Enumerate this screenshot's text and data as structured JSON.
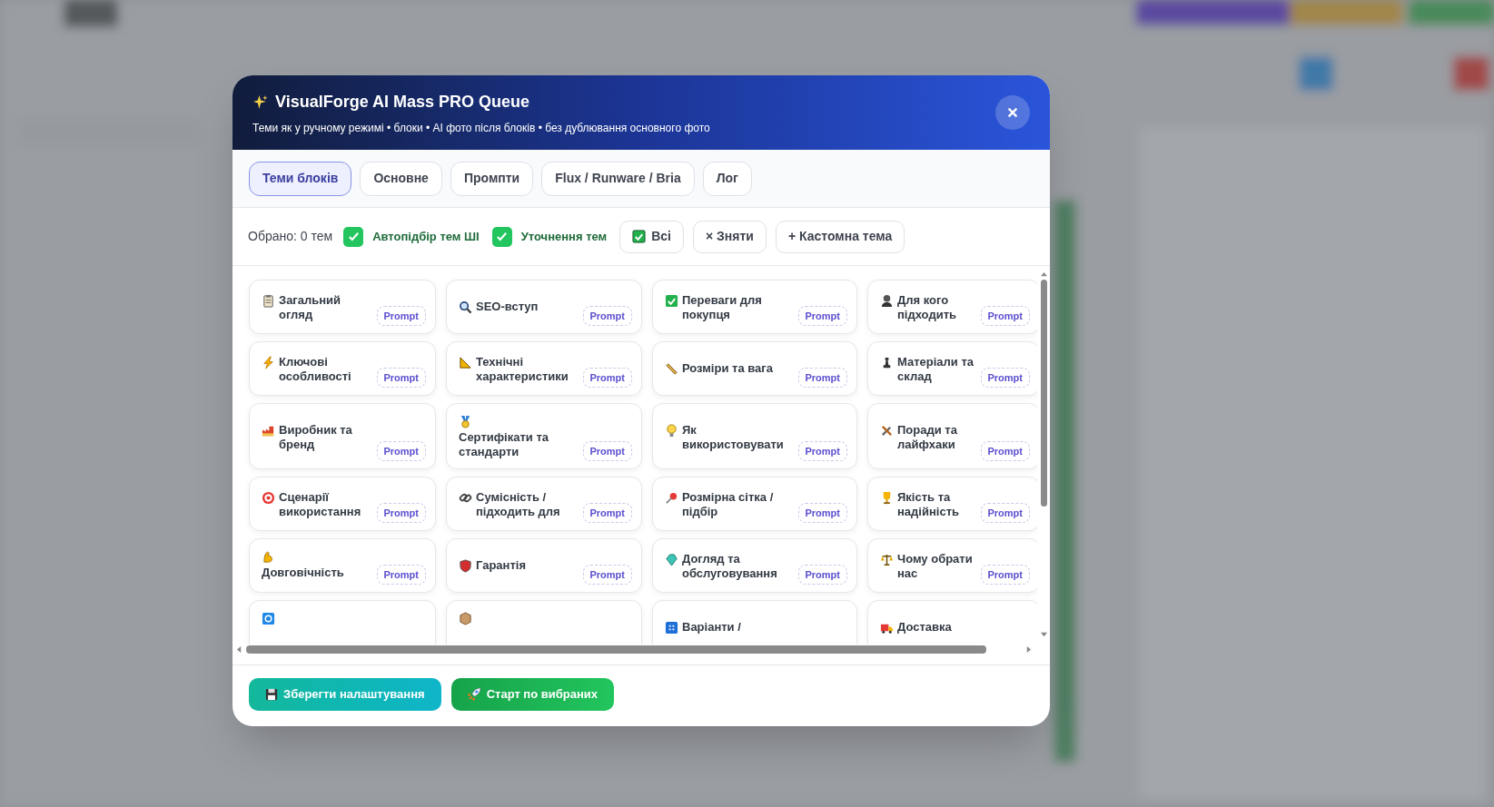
{
  "dialog": {
    "title": "VisualForge AI Mass PRO Queue",
    "subtitle": "Теми як у ручному режимі • блоки • AI фото після блоків • без дублювання основного фото"
  },
  "tabs": [
    {
      "label": "Теми блоків",
      "selected": true
    },
    {
      "label": "Основне",
      "selected": false
    },
    {
      "label": "Промпти",
      "selected": false
    },
    {
      "label": "Flux / Runware / Bria",
      "selected": false
    },
    {
      "label": "Лог",
      "selected": false
    }
  ],
  "filter_bar": {
    "selected_count": "Обрано: 0 тем",
    "toggles": [
      {
        "label": "Автопідбір тем ШІ",
        "checked": true
      },
      {
        "label": "Уточнення тем",
        "checked": true
      }
    ],
    "buttons": [
      {
        "kind": "check",
        "label": "Всі"
      },
      {
        "kind": "plain",
        "label": "× Зняти"
      },
      {
        "kind": "plain",
        "label": "+ Кастомна тема"
      }
    ]
  },
  "topics": [
    {
      "kind": "inline",
      "title": "Загальний огляд",
      "badge": "Prompt"
    },
    {
      "kind": "inline",
      "title": "SEO-вступ",
      "badge": "Prompt"
    },
    {
      "kind": "inline",
      "title": "Переваги для покупця",
      "badge": "Prompt"
    },
    {
      "kind": "inline",
      "title": "Для кого підходить",
      "badge": "Prompt"
    },
    {
      "kind": "inline",
      "title": "Ключові особливості",
      "badge": "Prompt"
    },
    {
      "kind": "inline",
      "title": "Технічні характеристики",
      "badge": "Prompt"
    },
    {
      "kind": "inline",
      "title": "Розміри та вага",
      "badge": "Prompt"
    },
    {
      "kind": "inline",
      "title": "Матеріали та склад",
      "badge": "Prompt"
    },
    {
      "kind": "inline",
      "title": "Виробник та бренд",
      "badge": "Prompt"
    },
    {
      "kind": "stacked",
      "title": "Сертифікати та стандарти",
      "badge": "Prompt"
    },
    {
      "kind": "inline",
      "title": "Як використовувати",
      "badge": "Prompt"
    },
    {
      "kind": "inline",
      "title": "Поради та лайфхаки",
      "badge": "Prompt"
    },
    {
      "kind": "inline",
      "title": "Сценарії використання",
      "badge": "Prompt"
    },
    {
      "kind": "inline",
      "title": "Сумісність / підходить для",
      "badge": "Prompt"
    },
    {
      "kind": "inline",
      "title": "Розмірна сітка / підбір",
      "badge": "Prompt"
    },
    {
      "kind": "inline",
      "title": "Якість та надійність",
      "badge": "Prompt"
    },
    {
      "kind": "stacked",
      "title": "Довговічність",
      "badge": "Prompt"
    },
    {
      "kind": "inline",
      "title": "Гарантія",
      "badge": "Prompt"
    },
    {
      "kind": "inline",
      "title": "Догляд та обслуговування",
      "badge": "Prompt"
    },
    {
      "kind": "inline",
      "title": "Чому обрати нас",
      "badge": "Prompt"
    },
    {
      "kind": "icon-only"
    },
    {
      "kind": "icon-only"
    },
    {
      "kind": "inline",
      "title": "Варіанти /"
    },
    {
      "kind": "inline",
      "title": "Доставка"
    }
  ],
  "footer_buttons": [
    {
      "kind": "save",
      "label": "Зберегти налаштування"
    },
    {
      "kind": "start",
      "label": "Старт по вибраних"
    }
  ]
}
